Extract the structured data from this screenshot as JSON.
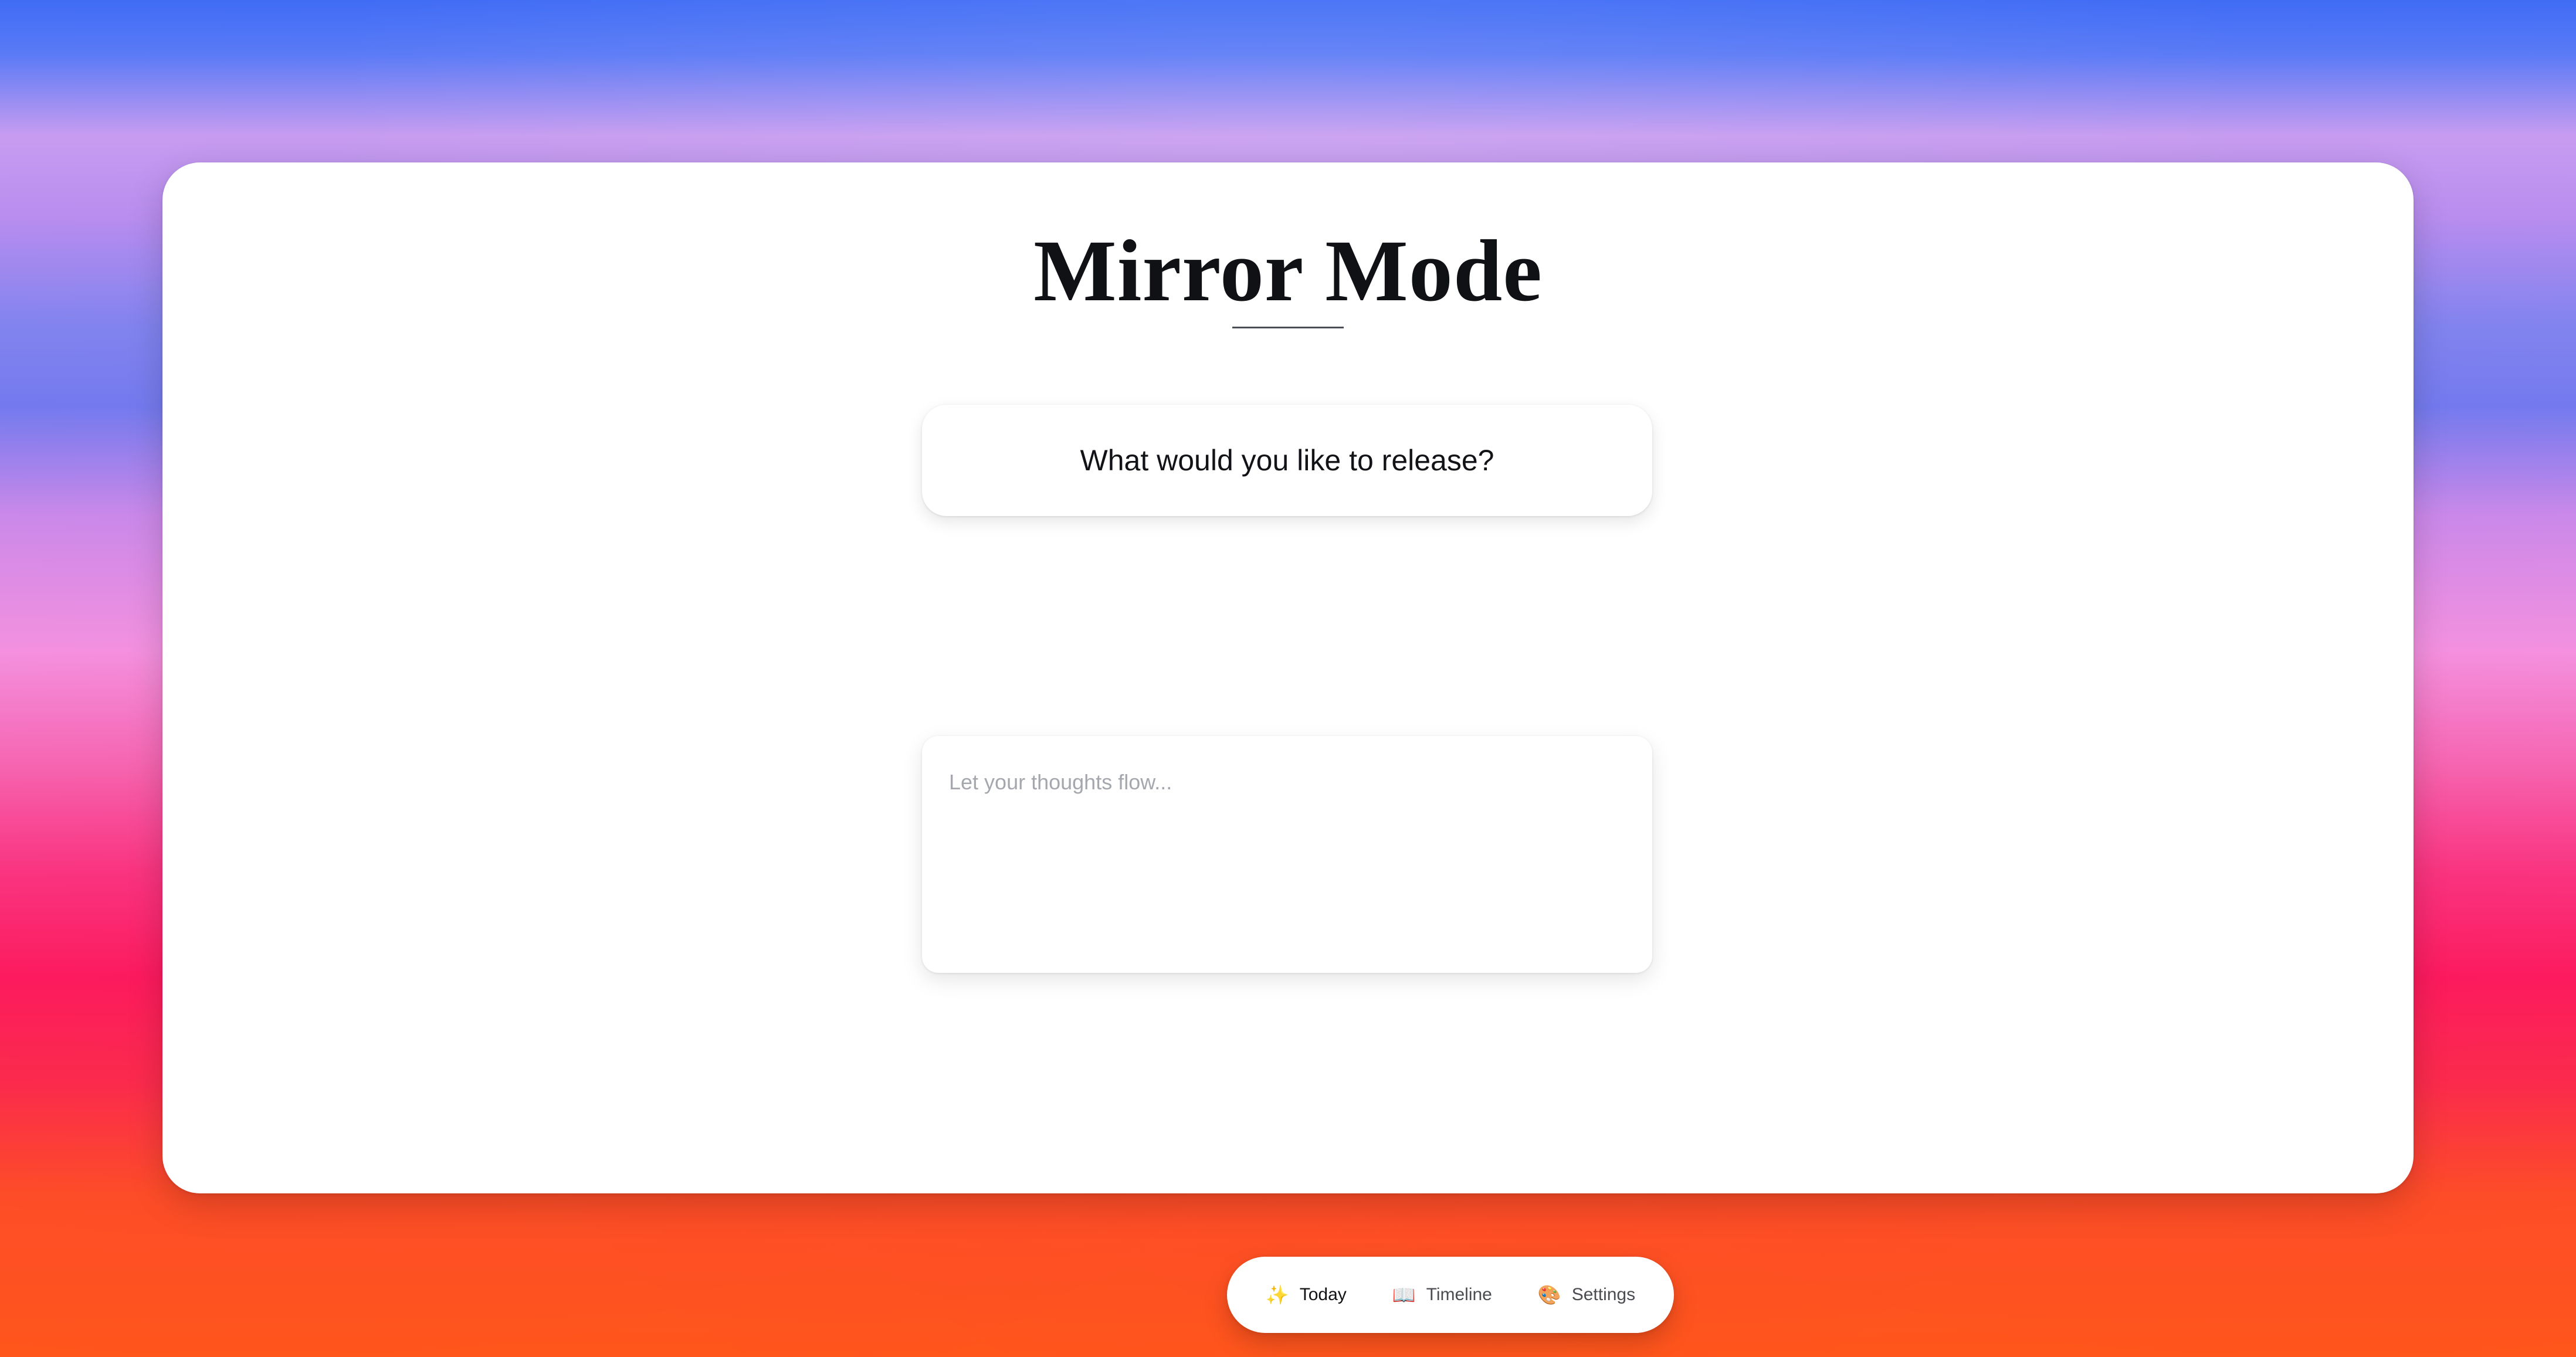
{
  "app": {
    "title": "Mirror Mode"
  },
  "prompt": {
    "question": "What would you like to release?"
  },
  "entry": {
    "placeholder": "Let your thoughts flow...",
    "value": ""
  },
  "nav": {
    "items": [
      {
        "label": "Today",
        "icon": "sparkles-icon",
        "glyph": "✨",
        "active": true
      },
      {
        "label": "Timeline",
        "icon": "open-book-icon",
        "glyph": "📖",
        "active": false
      },
      {
        "label": "Settings",
        "icon": "palette-icon",
        "glyph": "🎨",
        "active": false
      }
    ]
  },
  "colors": {
    "card_bg": "#ffffff",
    "title": "#0f1115",
    "placeholder": "#a4a7ae",
    "nav_text": "#4a4c52",
    "nav_active": "#111216"
  }
}
